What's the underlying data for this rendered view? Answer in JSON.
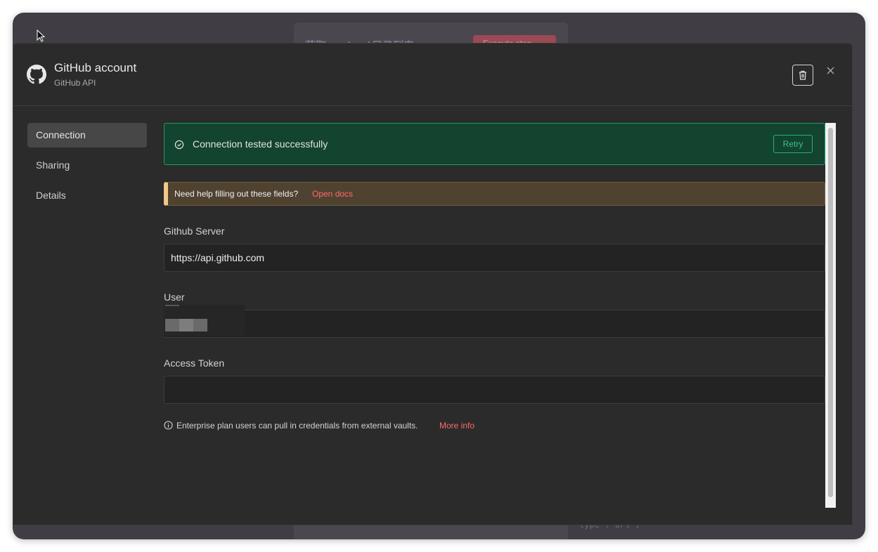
{
  "background": {
    "node_title": "获取content目录列表",
    "node_button": "Execute step",
    "code_bottom": "type : url ,"
  },
  "modal": {
    "title": "GitHub account",
    "subtitle": "GitHub API",
    "delete_icon": "trash-icon",
    "close_icon": "close-icon"
  },
  "sidebar": {
    "items": [
      {
        "label": "Connection",
        "active": true
      },
      {
        "label": "Sharing",
        "active": false
      },
      {
        "label": "Details",
        "active": false
      }
    ]
  },
  "success_banner": {
    "text": "Connection tested successfully",
    "retry_label": "Retry",
    "icon": "check-circle-icon"
  },
  "help_banner": {
    "text": "Need help filling out these fields?",
    "link": "Open docs"
  },
  "fields": {
    "github_server": {
      "label": "Github Server",
      "value": "https://api.github.com"
    },
    "user": {
      "label": "User",
      "value": ""
    },
    "access_token": {
      "label": "Access Token",
      "value": ""
    }
  },
  "info": {
    "text": "Enterprise plan users can pull in credentials from external vaults.",
    "link": "More info",
    "icon": "info-icon"
  },
  "colors": {
    "success_border": "#1f9b66",
    "link": "#ff6a6a",
    "help_accent": "#f0c988"
  }
}
